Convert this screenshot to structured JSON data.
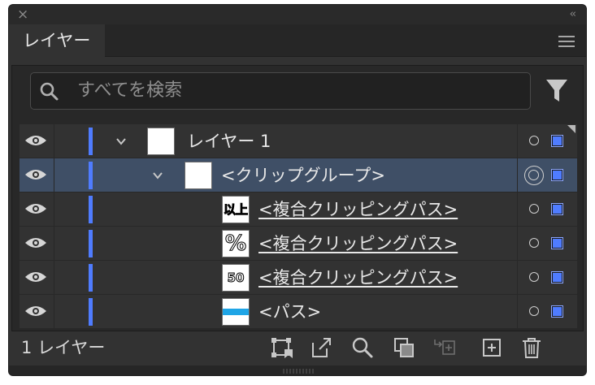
{
  "panel": {
    "tab_label": "レイヤー",
    "close_glyph": "×",
    "collapse_glyph": "‹‹"
  },
  "search": {
    "placeholder": "すべてを検索"
  },
  "layers": [
    {
      "label": "レイヤー 1",
      "thumbnail": "blank",
      "expanded": true,
      "selected": false,
      "target": "single",
      "underline": false
    },
    {
      "label": "<クリップグループ>",
      "thumbnail": "blank",
      "expanded": true,
      "selected": true,
      "target": "double",
      "underline": false
    },
    {
      "label": "<複合クリッピングパス>",
      "thumbnail": "text",
      "thumb_text": "以上",
      "expanded": false,
      "selected": false,
      "target": "single",
      "underline": true
    },
    {
      "label": "<複合クリッピングパス>",
      "thumbnail": "text",
      "thumb_text": "%",
      "expanded": false,
      "selected": false,
      "target": "single",
      "underline": true
    },
    {
      "label": "<複合クリッピングパス>",
      "thumbnail": "text",
      "thumb_text": "50",
      "expanded": false,
      "selected": false,
      "target": "single",
      "underline": true
    },
    {
      "label": "<パス>",
      "thumbnail": "stripe",
      "expanded": false,
      "selected": false,
      "target": "single",
      "underline": false
    }
  ],
  "footer": {
    "layer_count": "1 レイヤー",
    "icons": [
      "artboard-collect-icon",
      "export-icon",
      "locate-object-icon",
      "clipping-mask-icon",
      "new-sublayer-icon",
      "new-layer-icon",
      "delete-icon"
    ]
  },
  "colors": {
    "layer_color": "#4f7cff",
    "selection_row": "#3f4f66",
    "panel_bg": "#323232"
  }
}
